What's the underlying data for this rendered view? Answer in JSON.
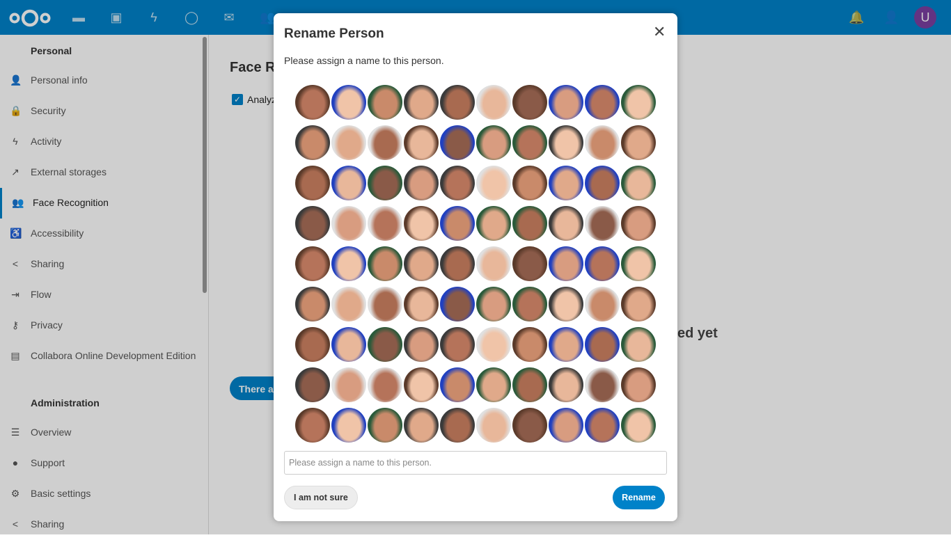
{
  "header": {
    "apps": [
      {
        "name": "files-icon",
        "glyph": "▬"
      },
      {
        "name": "photos-icon",
        "glyph": "▣"
      },
      {
        "name": "activity-icon",
        "glyph": "ϟ"
      },
      {
        "name": "talk-icon",
        "glyph": "◯"
      },
      {
        "name": "mail-icon",
        "glyph": "✉"
      },
      {
        "name": "contacts-icon",
        "glyph": "👥"
      },
      {
        "name": "calendar-icon",
        "glyph": "▦"
      }
    ],
    "avatar_letter": "U",
    "brand_color": "#0082c9",
    "avatar_color": "#7b3fa0"
  },
  "sidebar": {
    "personal_heading": "Personal",
    "personal": [
      {
        "label": "Personal info",
        "icon": "👤"
      },
      {
        "label": "Security",
        "icon": "🔒"
      },
      {
        "label": "Activity",
        "icon": "ϟ"
      },
      {
        "label": "External storages",
        "icon": "↗"
      },
      {
        "label": "Face Recognition",
        "icon": "👥",
        "active": true
      },
      {
        "label": "Accessibility",
        "icon": "♿"
      },
      {
        "label": "Sharing",
        "icon": "<"
      },
      {
        "label": "Flow",
        "icon": "⇥"
      },
      {
        "label": "Privacy",
        "icon": "⚷"
      },
      {
        "label": "Collabora Online Development Edition",
        "icon": "▤"
      }
    ],
    "admin_heading": "Administration",
    "admin": [
      {
        "label": "Overview",
        "icon": "☰"
      },
      {
        "label": "Support",
        "icon": "●"
      },
      {
        "label": "Basic settings",
        "icon": "⚙"
      },
      {
        "label": "Sharing",
        "icon": "<"
      }
    ]
  },
  "main": {
    "title_fragment": "Face Re",
    "checkbox_fragment": "Analyz",
    "status_fragment": "ed yet",
    "button_fragment": "There ar"
  },
  "dialog": {
    "title": "Rename Person",
    "subtitle": "Please assign a name to this person.",
    "input_placeholder": "Please assign a name to this person.",
    "input_value": "",
    "unsure_label": "I am not sure",
    "rename_label": "Rename",
    "face_count": 90
  }
}
